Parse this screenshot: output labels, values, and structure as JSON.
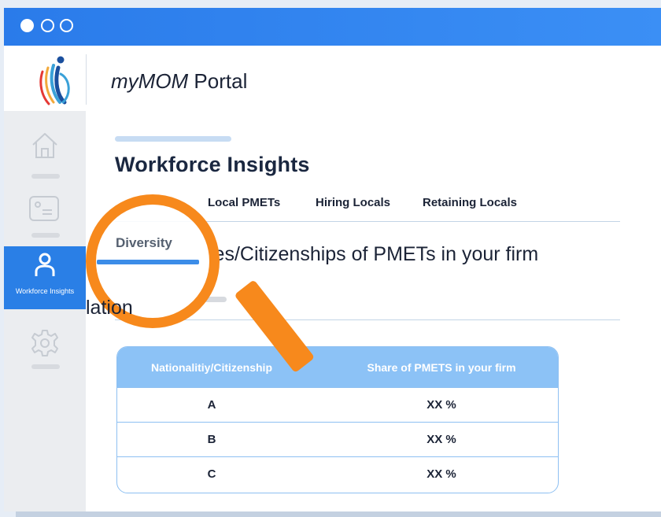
{
  "window": {
    "controls": [
      "close",
      "minimize",
      "maximize"
    ]
  },
  "header": {
    "brand_prefix": "myMOM",
    "brand_suffix": " Portal",
    "logo_icon": "mom-logo-icon"
  },
  "sidebar": {
    "items": [
      {
        "icon": "home-icon",
        "label": ""
      },
      {
        "icon": "id-card-icon",
        "label": ""
      },
      {
        "icon": "person-icon",
        "label": "Workforce Insights",
        "active": true
      },
      {
        "icon": "gear-icon",
        "label": ""
      }
    ]
  },
  "main": {
    "title": "Workforce Insights",
    "tabs": [
      {
        "label": "Diversity",
        "active": true
      },
      {
        "label": "Local PMETs"
      },
      {
        "label": "Hiring Locals"
      },
      {
        "label": "Retaining Locals"
      }
    ],
    "section_heading": "Nationalities/Citizenships of PMETs in your firm",
    "section_heading_visible": "ies/Citizenships of PMETs in your firm",
    "sub_heading": "Nationalities",
    "sub_heading_visible": "lation"
  },
  "table": {
    "headers": [
      "Nationalitiy/Citizenship",
      "Share of PMETS in your firm"
    ],
    "rows": [
      {
        "nationality": "A",
        "share": "XX %"
      },
      {
        "nationality": "B",
        "share": "XX %"
      },
      {
        "nationality": "C",
        "share": "XX %"
      }
    ]
  },
  "colors": {
    "titlebar": "#2a7bea",
    "sidebar_active": "#2a7fe6",
    "table_header": "#8cc2f6",
    "magnifier": "#f7891c"
  }
}
